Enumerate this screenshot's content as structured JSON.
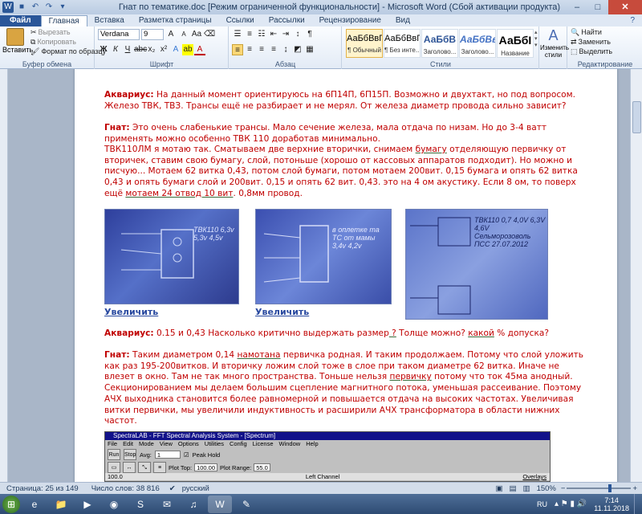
{
  "window": {
    "title": "Гнат по тематике.doc [Режим ограниченной функциональности] - Microsoft Word (Сбой активации продукта)"
  },
  "tabs": [
    "Файл",
    "Главная",
    "Вставка",
    "Разметка страницы",
    "Ссылки",
    "Рассылки",
    "Рецензирование",
    "Вид"
  ],
  "ribbon": {
    "clipboard": {
      "paste": "Вставить",
      "cut": "Вырезать",
      "copy": "Копировать",
      "format_painter": "Формат по образцу",
      "label": "Буфер обмена"
    },
    "font": {
      "name": "Verdana",
      "size": "9",
      "label": "Шрифт"
    },
    "paragraph": {
      "label": "Абзац"
    },
    "styles": {
      "label": "Стили",
      "items": [
        {
          "sample": "АаБбВвГг,",
          "name": "¶ Обычный"
        },
        {
          "sample": "АаБбВвГг,",
          "name": "¶ Без инте..."
        },
        {
          "sample": "АаБбВ",
          "name": "Заголово..."
        },
        {
          "sample": "АаБбВв",
          "name": "Заголово..."
        },
        {
          "sample": "АаБбІ",
          "name": "Название"
        }
      ],
      "change": "Изменить стили"
    },
    "editing": {
      "find": "Найти",
      "replace": "Заменить",
      "select": "Выделить",
      "label": "Редактирование"
    }
  },
  "doc": {
    "p1_speaker": "Аквариус:",
    "p1_text": " На данный момент ориентируюсь на 6П14П, 6П15П.  Возможно и двухтакт, но под вопросом. Железо ТВК, ТВЗ. Трансы ещё не разбирает и не мерял. От железа диаметр провода сильно зависит?",
    "p2_speaker": "Гнат:",
    "p2_text": " Это очень слабенькие трансы. Мало  сечение железа, мала отдача по низам. Но до 3-4 ватт применять можно особенно ТВК 110 доработав минимально.",
    "p3_a": "ТВК110ЛМ я мотаю так. Сматываем две верхние вторички, снимаем ",
    "p3_u1": "бумагу",
    "p3_b": " отделяющую первичку от вторичек, ставим свою бумагу, слой, потоньше (хорошо от кассовых аппаратов подходит). Но можно и писчую... Мотаем 62 витка 0,43, потом слой бумаги, потом мотаем 200вит. 0,15 бумага и опять 62 витка 0,43 и опять бумаги слой и 200вит.  0,15 и опять 62 вит. 0,43. это на 4 ом акустику. Если 8 ом, то поверх ещё ",
    "p3_u2": "мотаем 24 отвод 10 вит",
    "p3_c": ". 0,8мм провод.",
    "link1": "Увеличить",
    "link2": "Увеличить",
    "photo1_text": "ТВК110 6,3v 5,3v 4,5v",
    "photo2_text": "в оплетке та ТС от мамы 3,4v 4,2v",
    "photo3_text": "ТВК110 0,7 4,0V 6,3V 4,6V Сельморозоволь ПСС 27.07.2012",
    "p4_speaker": "Аквариус:",
    "p4_a": " 0.15 и 0,43 Насколько критично выдержать размер",
    "p4_u1": " ?",
    "p4_b": " Толще можно? ",
    "p4_u2": "какой",
    "p4_c": " % допуска?",
    "p5_speaker": "Гнат:",
    "p5_a": " Таким диаметром 0,14 ",
    "p5_u1": "намотана",
    "p5_b": " первичка родная. И таким продолжаем. Потому что слой уложить как раз 195-200витков. И вторичку ложим слой тоже в слое при таком диаметре 62 витка. Иначе не влезет в окно. Там не так много пространства. Тоньше нельзя ",
    "p5_u2": "первичку",
    "p5_c": " потому что ток 45ма анодный. Секционированием мы делаем большим сцепление магнитного потока, уменьшая рассеивание. Поэтому АЧХ выходника становится более равномерной и повышается отдача на высоких частотах. Увеличивая витки первички, мы увеличили индуктивность и расширили АЧХ трансформатора в области нижних частот."
  },
  "spectra": {
    "title": "SpectraLAB - FFT Spectral Analysis System - [Spectrum]",
    "menu": [
      "File",
      "Edit",
      "Mode",
      "View",
      "Options",
      "Utilities",
      "Config",
      "License",
      "Window",
      "Help"
    ],
    "run": "Run",
    "stop": "Stop",
    "avg_label": "Avg:",
    "avg_value": "1",
    "peak_hold": "Peak Hold",
    "plot_top_label": "Plot Top:",
    "plot_top": "100.00",
    "plot_range_label": "Plot Range:",
    "plot_range": "55.0",
    "channel": "Left Channel",
    "overlays": "Overlays",
    "value": "100.0"
  },
  "status": {
    "page": "Страница: 25 из 149",
    "words": "Число слов: 38 816",
    "lang": "русский",
    "zoom": "150%"
  },
  "taskbar": {
    "lang": "RU",
    "time": "7:14",
    "date": "11.11.2018"
  }
}
